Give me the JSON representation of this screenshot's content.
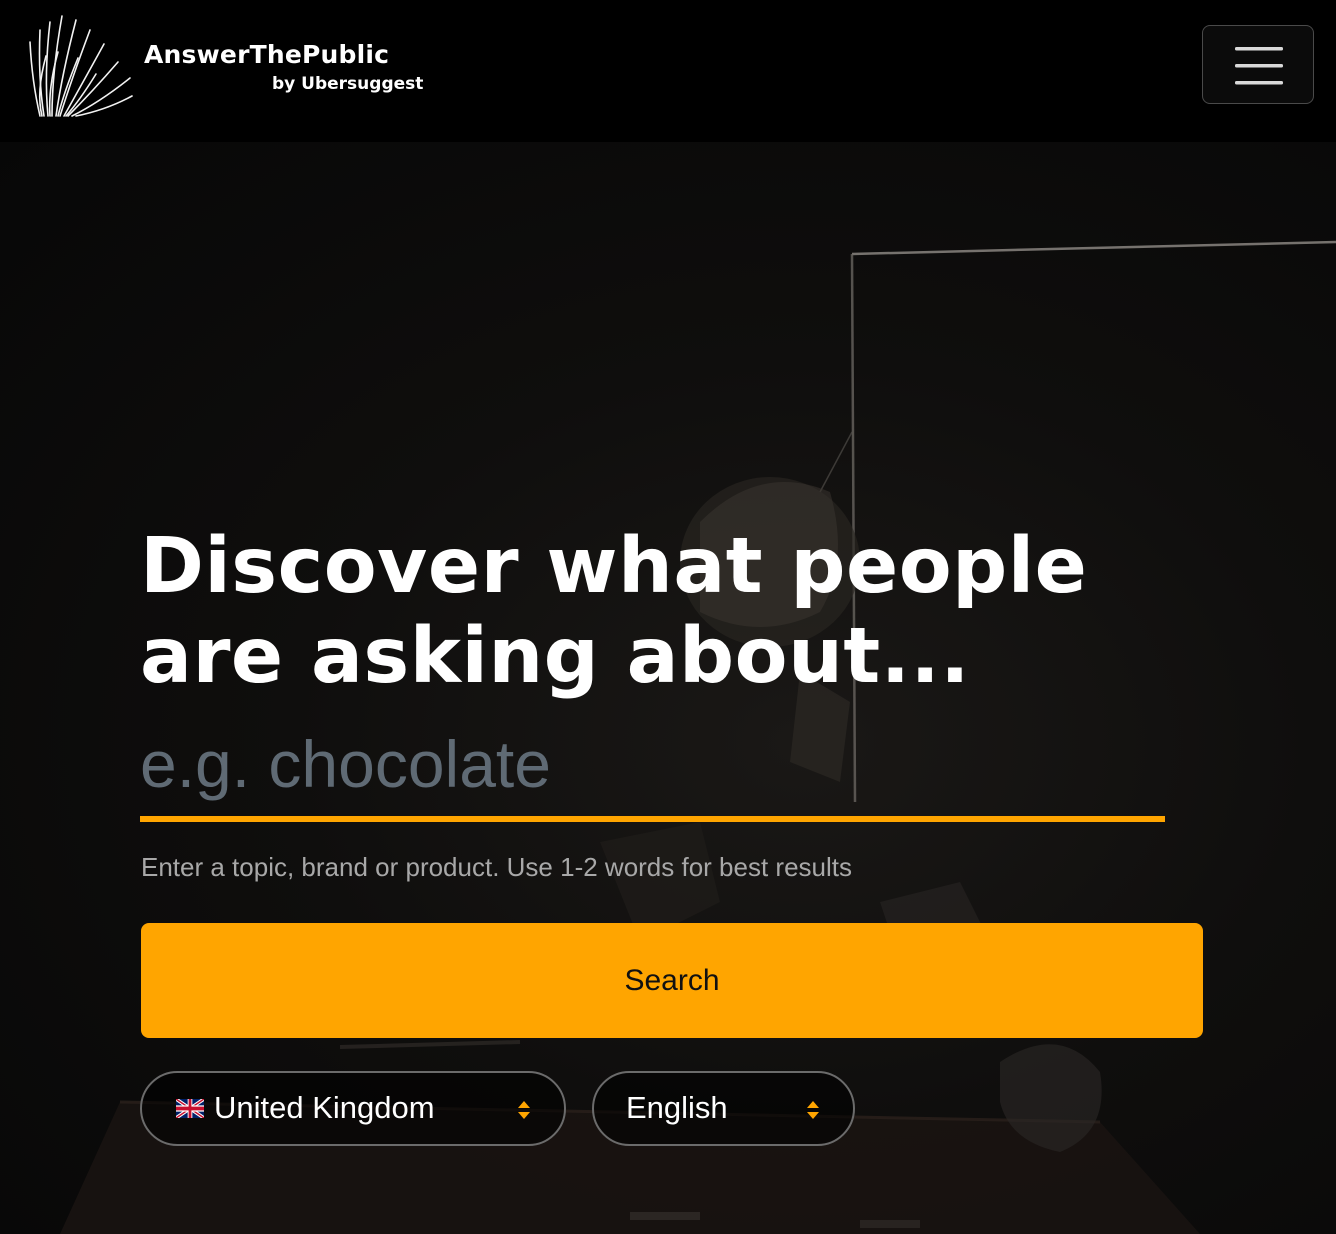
{
  "header": {
    "brand_name": "AnswerThePublic",
    "brand_sub": "by Ubersuggest",
    "menu_icon": "hamburger-menu-icon"
  },
  "hero": {
    "headline_line1": "Discover what people",
    "headline_line2": "are asking about...",
    "search_placeholder": "e.g. chocolate",
    "hint": "Enter a topic, brand or product. Use 1-2 words for best results",
    "search_button": "Search"
  },
  "selectors": {
    "country": {
      "value": "United Kingdom",
      "icon": "uk-flag-icon"
    },
    "language": {
      "value": "English"
    }
  },
  "colors": {
    "accent": "#ffa500",
    "background": "#000000",
    "placeholder": "#5f6a74",
    "hint": "#a8a8a8"
  }
}
